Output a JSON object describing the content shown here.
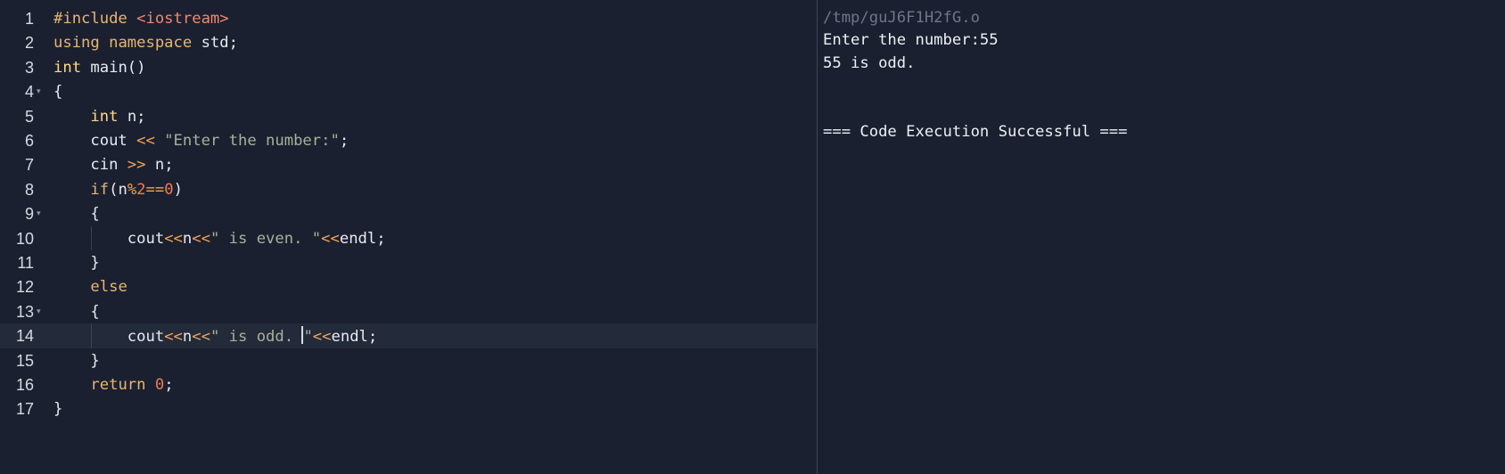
{
  "editor": {
    "lines": [
      {
        "num": "1",
        "fold": "",
        "tokens": [
          {
            "t": "#include ",
            "c": "kw"
          },
          {
            "t": "<iostream>",
            "c": "inc"
          }
        ]
      },
      {
        "num": "2",
        "fold": "",
        "tokens": [
          {
            "t": "using ",
            "c": "kw"
          },
          {
            "t": "namespace ",
            "c": "kw"
          },
          {
            "t": "std;",
            "c": "plain"
          }
        ]
      },
      {
        "num": "3",
        "fold": "",
        "tokens": [
          {
            "t": "int ",
            "c": "ty"
          },
          {
            "t": "main()",
            "c": "plain"
          }
        ]
      },
      {
        "num": "4",
        "fold": "▾",
        "tokens": [
          {
            "t": "{",
            "c": "plain"
          }
        ]
      },
      {
        "num": "5",
        "fold": "",
        "tokens": [
          {
            "t": "    ",
            "c": "plain"
          },
          {
            "t": "int ",
            "c": "ty"
          },
          {
            "t": "n;",
            "c": "plain"
          }
        ]
      },
      {
        "num": "6",
        "fold": "",
        "tokens": [
          {
            "t": "    cout ",
            "c": "plain"
          },
          {
            "t": "<<",
            "c": "op"
          },
          {
            "t": " ",
            "c": "plain"
          },
          {
            "t": "\"Enter the number:\"",
            "c": "str"
          },
          {
            "t": ";",
            "c": "plain"
          }
        ]
      },
      {
        "num": "7",
        "fold": "",
        "tokens": [
          {
            "t": "    cin ",
            "c": "plain"
          },
          {
            "t": ">>",
            "c": "op"
          },
          {
            "t": " n;",
            "c": "plain"
          }
        ]
      },
      {
        "num": "8",
        "fold": "",
        "tokens": [
          {
            "t": "    ",
            "c": "plain"
          },
          {
            "t": "if",
            "c": "kw"
          },
          {
            "t": "(n",
            "c": "plain"
          },
          {
            "t": "%",
            "c": "op"
          },
          {
            "t": "2",
            "c": "num"
          },
          {
            "t": "==",
            "c": "op"
          },
          {
            "t": "0",
            "c": "num"
          },
          {
            "t": ")",
            "c": "plain"
          }
        ]
      },
      {
        "num": "9",
        "fold": "▾",
        "tokens": [
          {
            "t": "    {",
            "c": "plain"
          }
        ]
      },
      {
        "num": "10",
        "fold": "",
        "guide": true,
        "tokens": [
          {
            "t": "        cout",
            "c": "plain"
          },
          {
            "t": "<<",
            "c": "op"
          },
          {
            "t": "n",
            "c": "plain"
          },
          {
            "t": "<<",
            "c": "op"
          },
          {
            "t": "\" is even. \"",
            "c": "str"
          },
          {
            "t": "<<",
            "c": "op"
          },
          {
            "t": "endl;",
            "c": "plain"
          }
        ]
      },
      {
        "num": "11",
        "fold": "",
        "tokens": [
          {
            "t": "    }",
            "c": "plain"
          }
        ]
      },
      {
        "num": "12",
        "fold": "",
        "tokens": [
          {
            "t": "    ",
            "c": "plain"
          },
          {
            "t": "else",
            "c": "kw"
          }
        ]
      },
      {
        "num": "13",
        "fold": "▾",
        "tokens": [
          {
            "t": "    {",
            "c": "plain"
          }
        ]
      },
      {
        "num": "14",
        "fold": "",
        "guide": true,
        "active": true,
        "tokens": [
          {
            "t": "        cout",
            "c": "plain"
          },
          {
            "t": "<<",
            "c": "op"
          },
          {
            "t": "n",
            "c": "plain"
          },
          {
            "t": "<<",
            "c": "op"
          },
          {
            "t": "\" is odd. ",
            "c": "str"
          },
          {
            "t": "",
            "c": "cursor"
          },
          {
            "t": "\"",
            "c": "str"
          },
          {
            "t": "<<",
            "c": "op"
          },
          {
            "t": "endl;",
            "c": "plain"
          }
        ]
      },
      {
        "num": "15",
        "fold": "",
        "tokens": [
          {
            "t": "    }",
            "c": "plain"
          }
        ]
      },
      {
        "num": "16",
        "fold": "",
        "tokens": [
          {
            "t": "    ",
            "c": "plain"
          },
          {
            "t": "return ",
            "c": "kw"
          },
          {
            "t": "0",
            "c": "num"
          },
          {
            "t": ";",
            "c": "plain"
          }
        ]
      },
      {
        "num": "17",
        "fold": "",
        "tokens": [
          {
            "t": "}",
            "c": "plain"
          }
        ]
      }
    ]
  },
  "output": {
    "file_path": "/tmp/guJ6F1H2fG.o",
    "prompt_line": "Enter the number:55",
    "result_line": "55 is odd.",
    "status_line": "=== Code Execution Successful ==="
  },
  "colors": {
    "background": "#1b2030",
    "keyword": "#e6b673",
    "type": "#ffd98a",
    "string": "#a9b09a",
    "operator": "#f0a456",
    "number": "#f07b52",
    "include": "#f0876e",
    "text": "#e8eaf0"
  }
}
